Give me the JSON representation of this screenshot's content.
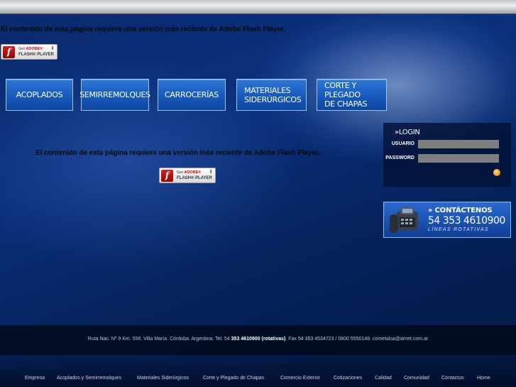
{
  "flash": {
    "message": "El contenido de esta página requiere una versión más reciente de Adobe Flash Player.",
    "badge_get": "Get",
    "badge_adobe": "ADOBE®",
    "badge_product": "FLASH® PLAYER"
  },
  "nav": {
    "acoplados": "ACOPLADOS",
    "semirremolques": "SEMIRREMOLQUES",
    "carrocerias": "CARROCERÍAS",
    "materiales_1": "MATERIALES",
    "materiales_2": "SIDERÚRGICOS",
    "corte_1": "CORTE Y PLEGADO",
    "corte_2": "DE CHAPAS"
  },
  "login": {
    "title": "LOGIN",
    "user_label": "USUARIO",
    "password_label": "PASSWORD",
    "submit_icon": "arrow-right-icon"
  },
  "contact": {
    "title": "CONTÁCTENOS",
    "phone": "54 353 4610900",
    "subtitle": "LÍNEAS ROTATIVAS"
  },
  "footer": {
    "address_pre": "Ruta Nac. Nº 9 Km. 556. Villa María. Córdoba. Argentina. Tel. 54 ",
    "address_phone": "353 4610900",
    "address_mid": " (rotativas)",
    "address_post": ". Fax 54 353 4534723 / 0800 5550148. cometalsa@arnet.com.ar",
    "links": [
      "Empresa",
      "Acoplados y Semirremolques",
      "Materiales Siderúrgicos",
      "Corte y Plegado de Chapas",
      "Comercio Exterior",
      "Cotizaciones",
      "Calidad",
      "Comunidad",
      "Contactos",
      "Home"
    ]
  },
  "colors": {
    "background": "#0a2f7c",
    "nav_button": "#1a5fc0",
    "login_field": "#7e7e7e",
    "accent_orange": "#e07a00"
  }
}
